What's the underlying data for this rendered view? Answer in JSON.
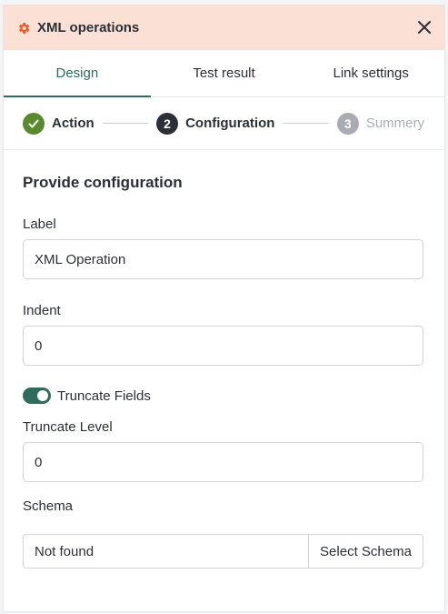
{
  "header": {
    "title": "XML operations",
    "icon": "gear-icon",
    "close_icon": "close-icon"
  },
  "tabs": [
    {
      "label": "Design",
      "active": true
    },
    {
      "label": "Test result",
      "active": false
    },
    {
      "label": "Link settings",
      "active": false
    }
  ],
  "stepper": {
    "steps": [
      {
        "number": "",
        "label": "Action",
        "state": "done"
      },
      {
        "number": "2",
        "label": "Configuration",
        "state": "current"
      },
      {
        "number": "3",
        "label": "Summery",
        "state": "pending"
      }
    ]
  },
  "form": {
    "section_title": "Provide configuration",
    "label_field": {
      "label": "Label",
      "value": "XML Operation"
    },
    "indent_field": {
      "label": "Indent",
      "value": "0"
    },
    "truncate_toggle": {
      "label": "Truncate Fields",
      "on": true
    },
    "truncate_level_field": {
      "label": "Truncate Level",
      "value": "0"
    },
    "schema": {
      "label": "Schema",
      "value": "Not found",
      "button_label": "Select Schema"
    }
  },
  "colors": {
    "header_bg": "#fbe0d6",
    "accent": "#2f6b5e",
    "gear": "#e8612c",
    "step_done": "#5a8a2e"
  }
}
